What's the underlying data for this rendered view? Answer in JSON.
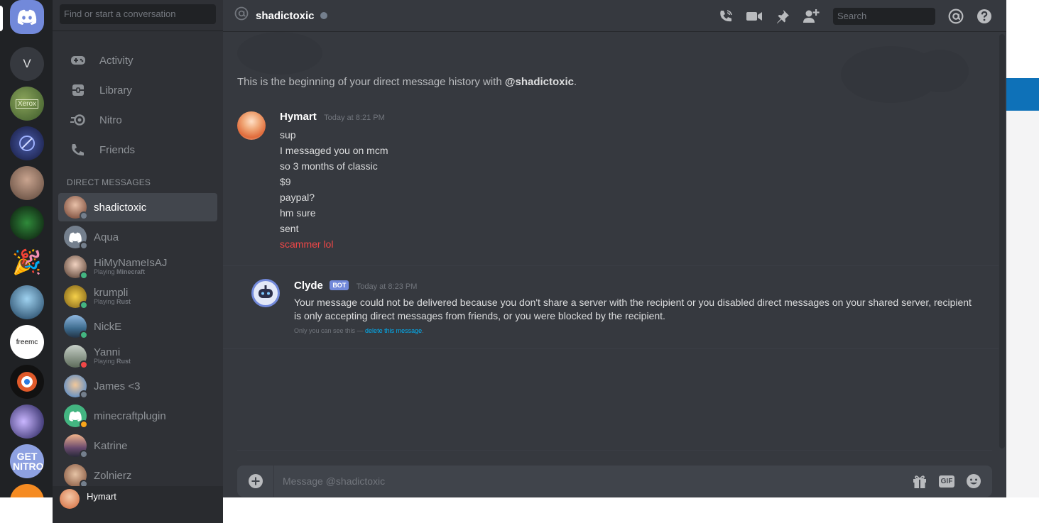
{
  "colors": {
    "blurple": "#7289da",
    "online": "#43b581",
    "idle": "#faa61a",
    "dnd": "#f04747",
    "offline": "#747f8d",
    "link": "#00b0f4"
  },
  "guilds": [
    {
      "name": "home",
      "icon": "discord-logo-icon"
    },
    {
      "name": "V",
      "text": "V"
    },
    {
      "name": "Xerox",
      "text": "Xerox"
    },
    {
      "name": "server-3"
    },
    {
      "name": "server-4"
    },
    {
      "name": "server-5"
    },
    {
      "name": "server-6",
      "icon": "party-popper-icon"
    },
    {
      "name": "server-7"
    },
    {
      "name": "freemc",
      "text": "freemc"
    },
    {
      "name": "server-9"
    },
    {
      "name": "server-10"
    },
    {
      "name": "nitro",
      "text": "GET NITRO"
    },
    {
      "name": "server-12"
    }
  ],
  "sidebar": {
    "search_placeholder": "Find or start a conversation",
    "nav": [
      {
        "label": "Activity",
        "icon": "gamepad-icon"
      },
      {
        "label": "Library",
        "icon": "library-icon"
      },
      {
        "label": "Nitro",
        "icon": "nitro-icon"
      },
      {
        "label": "Friends",
        "icon": "friends-icon"
      }
    ],
    "dm_header": "DIRECT MESSAGES",
    "dms": [
      {
        "name": "shadictoxic",
        "status": "offline",
        "active": true
      },
      {
        "name": "Aqua",
        "status": "offline"
      },
      {
        "name": "HiMyNameIsAJ",
        "status": "online",
        "activity_prefix": "Playing ",
        "activity_game": "Minecraft"
      },
      {
        "name": "krumpli",
        "status": "online",
        "activity_prefix": "Playing ",
        "activity_game": "Rust"
      },
      {
        "name": "NickE",
        "status": "online"
      },
      {
        "name": "Yanni",
        "status": "dnd",
        "activity_prefix": "Playing ",
        "activity_game": "Rust"
      },
      {
        "name": "James <3",
        "status": "offline"
      },
      {
        "name": "minecraftplugin",
        "status": "idle"
      },
      {
        "name": "Katrine",
        "status": "offline"
      },
      {
        "name": "Zolnierz",
        "status": "offline"
      }
    ],
    "current_user": "Hymart"
  },
  "header": {
    "channel_name": "shadictoxic",
    "search_placeholder": "Search"
  },
  "chat": {
    "beginning_prefix": "This is the beginning of your direct message history with ",
    "beginning_user": "@shadictoxic",
    "beginning_suffix": ".",
    "group1": {
      "author": "Hymart",
      "timestamp": "Today at 8:21 PM",
      "lines": [
        "sup",
        "I messaged you on mcm",
        "so 3 months of classic",
        "$9",
        "paypal?",
        "hm sure",
        "sent"
      ],
      "red_line": "scammer lol"
    },
    "group2": {
      "author": "Clyde",
      "bot_tag": "BOT",
      "timestamp": "Today at 8:23 PM",
      "text": "Your message could not be delivered because you don't share a server with the recipient or you disabled direct messages on your shared server, recipient is only accepting direct messages from friends, or you were blocked by the recipient.",
      "note_prefix": "Only you can see this — ",
      "note_link": "delete this message",
      "note_suffix": "."
    }
  },
  "composer": {
    "placeholder": "Message @shadictoxic",
    "gif_label": "GIF"
  }
}
